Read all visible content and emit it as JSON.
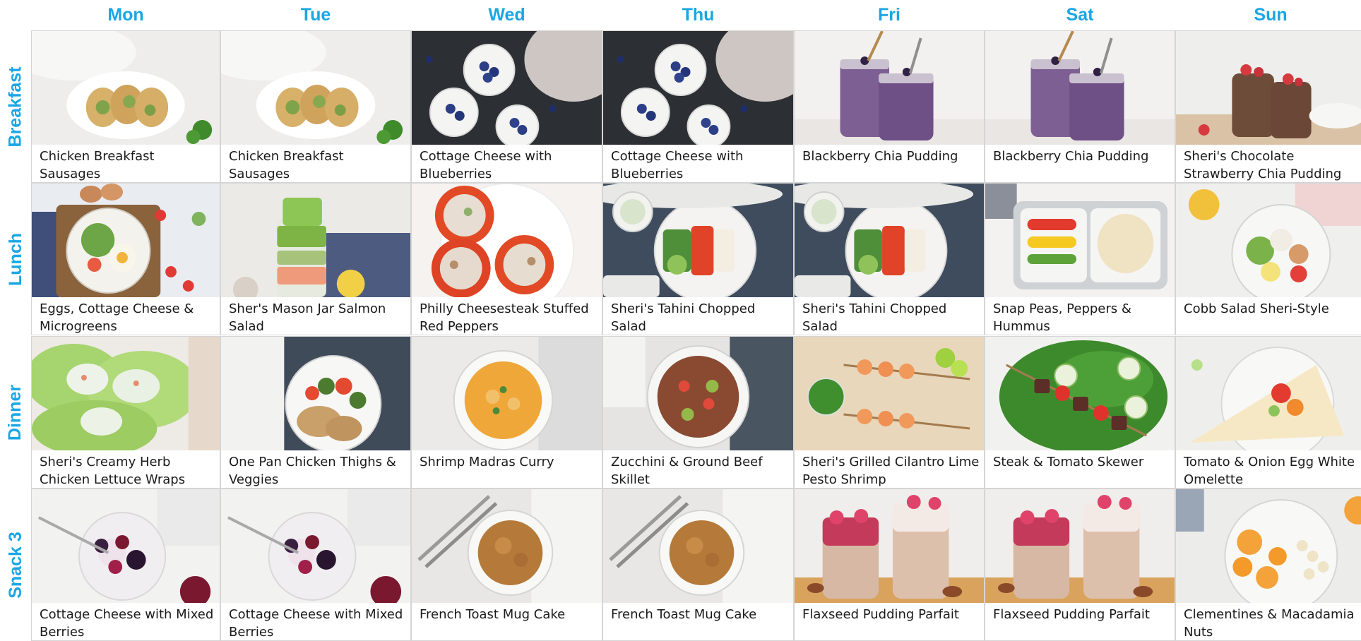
{
  "days": [
    "Mon",
    "Tue",
    "Wed",
    "Thu",
    "Fri",
    "Sat",
    "Sun"
  ],
  "meals": [
    {
      "label": "Breakfast",
      "items": [
        {
          "title": "Chicken Breakfast Sausages",
          "photo": "chicken-sausage-patties-photo"
        },
        {
          "title": "Chicken Breakfast Sausages",
          "photo": "chicken-sausage-patties-photo"
        },
        {
          "title": "Cottage Cheese with Blueberries",
          "photo": "cottage-cheese-blueberries-photo"
        },
        {
          "title": "Cottage Cheese with Blueberries",
          "photo": "cottage-cheese-blueberries-photo"
        },
        {
          "title": "Blackberry Chia Pudding",
          "photo": "blackberry-chia-jars-photo"
        },
        {
          "title": "Blackberry Chia Pudding",
          "photo": "blackberry-chia-jars-photo"
        },
        {
          "title": "Sheri's Chocolate Strawberry Chia Pudding",
          "photo": "chocolate-strawberry-chia-photo"
        }
      ]
    },
    {
      "label": "Lunch",
      "items": [
        {
          "title": "Eggs, Cottage Cheese & Microgreens",
          "photo": "eggs-microgreens-bowl-photo"
        },
        {
          "title": "Sher's Mason Jar Salmon Salad",
          "photo": "mason-jar-salad-photo"
        },
        {
          "title": "Philly Cheesesteak Stuffed Red Peppers",
          "photo": "stuffed-peppers-photo"
        },
        {
          "title": "Sheri's Tahini Chopped Salad",
          "photo": "tahini-chopped-salad-photo"
        },
        {
          "title": "Sheri's Tahini Chopped Salad",
          "photo": "tahini-chopped-salad-photo"
        },
        {
          "title": "Snap Peas, Peppers & Hummus",
          "photo": "snap-peas-hummus-box-photo"
        },
        {
          "title": "Cobb Salad Sheri-Style",
          "photo": "cobb-salad-photo"
        }
      ]
    },
    {
      "label": "Dinner",
      "items": [
        {
          "title": "Sheri's Creamy Herb Chicken Lettuce Wraps",
          "photo": "lettuce-wraps-photo"
        },
        {
          "title": "One Pan Chicken Thighs & Veggies",
          "photo": "chicken-thighs-veggies-photo"
        },
        {
          "title": "Shrimp Madras Curry",
          "photo": "madras-curry-bowl-photo"
        },
        {
          "title": "Zucchini & Ground Beef Skillet",
          "photo": "zucchini-beef-bowl-photo"
        },
        {
          "title": "Sheri's Grilled Cilantro Lime Pesto Shrimp",
          "photo": "shrimp-skewers-photo"
        },
        {
          "title": "Steak & Tomato Skewer",
          "photo": "steak-tomato-skewer-photo"
        },
        {
          "title": "Tomato & Onion Egg White Omelette",
          "photo": "egg-white-omelette-photo"
        }
      ]
    },
    {
      "label": "Snack 3",
      "items": [
        {
          "title": "Cottage Cheese with Mixed Berries",
          "photo": "cottage-cheese-berries-photo"
        },
        {
          "title": "Cottage Cheese with Mixed Berries",
          "photo": "cottage-cheese-berries-photo"
        },
        {
          "title": "French Toast Mug Cake",
          "photo": "mug-cake-photo"
        },
        {
          "title": "French Toast Mug Cake",
          "photo": "mug-cake-photo"
        },
        {
          "title": "Flaxseed Pudding Parfait",
          "photo": "flaxseed-parfait-photo"
        },
        {
          "title": "Flaxseed Pudding Parfait",
          "photo": "flaxseed-parfait-photo"
        },
        {
          "title": "Clementines & Macadamia Nuts",
          "photo": "clementines-nuts-photo"
        }
      ]
    }
  ],
  "colors": {
    "accent": "#1aa6e4",
    "border": "#d5d5d5",
    "text": "#1a1a1a"
  }
}
